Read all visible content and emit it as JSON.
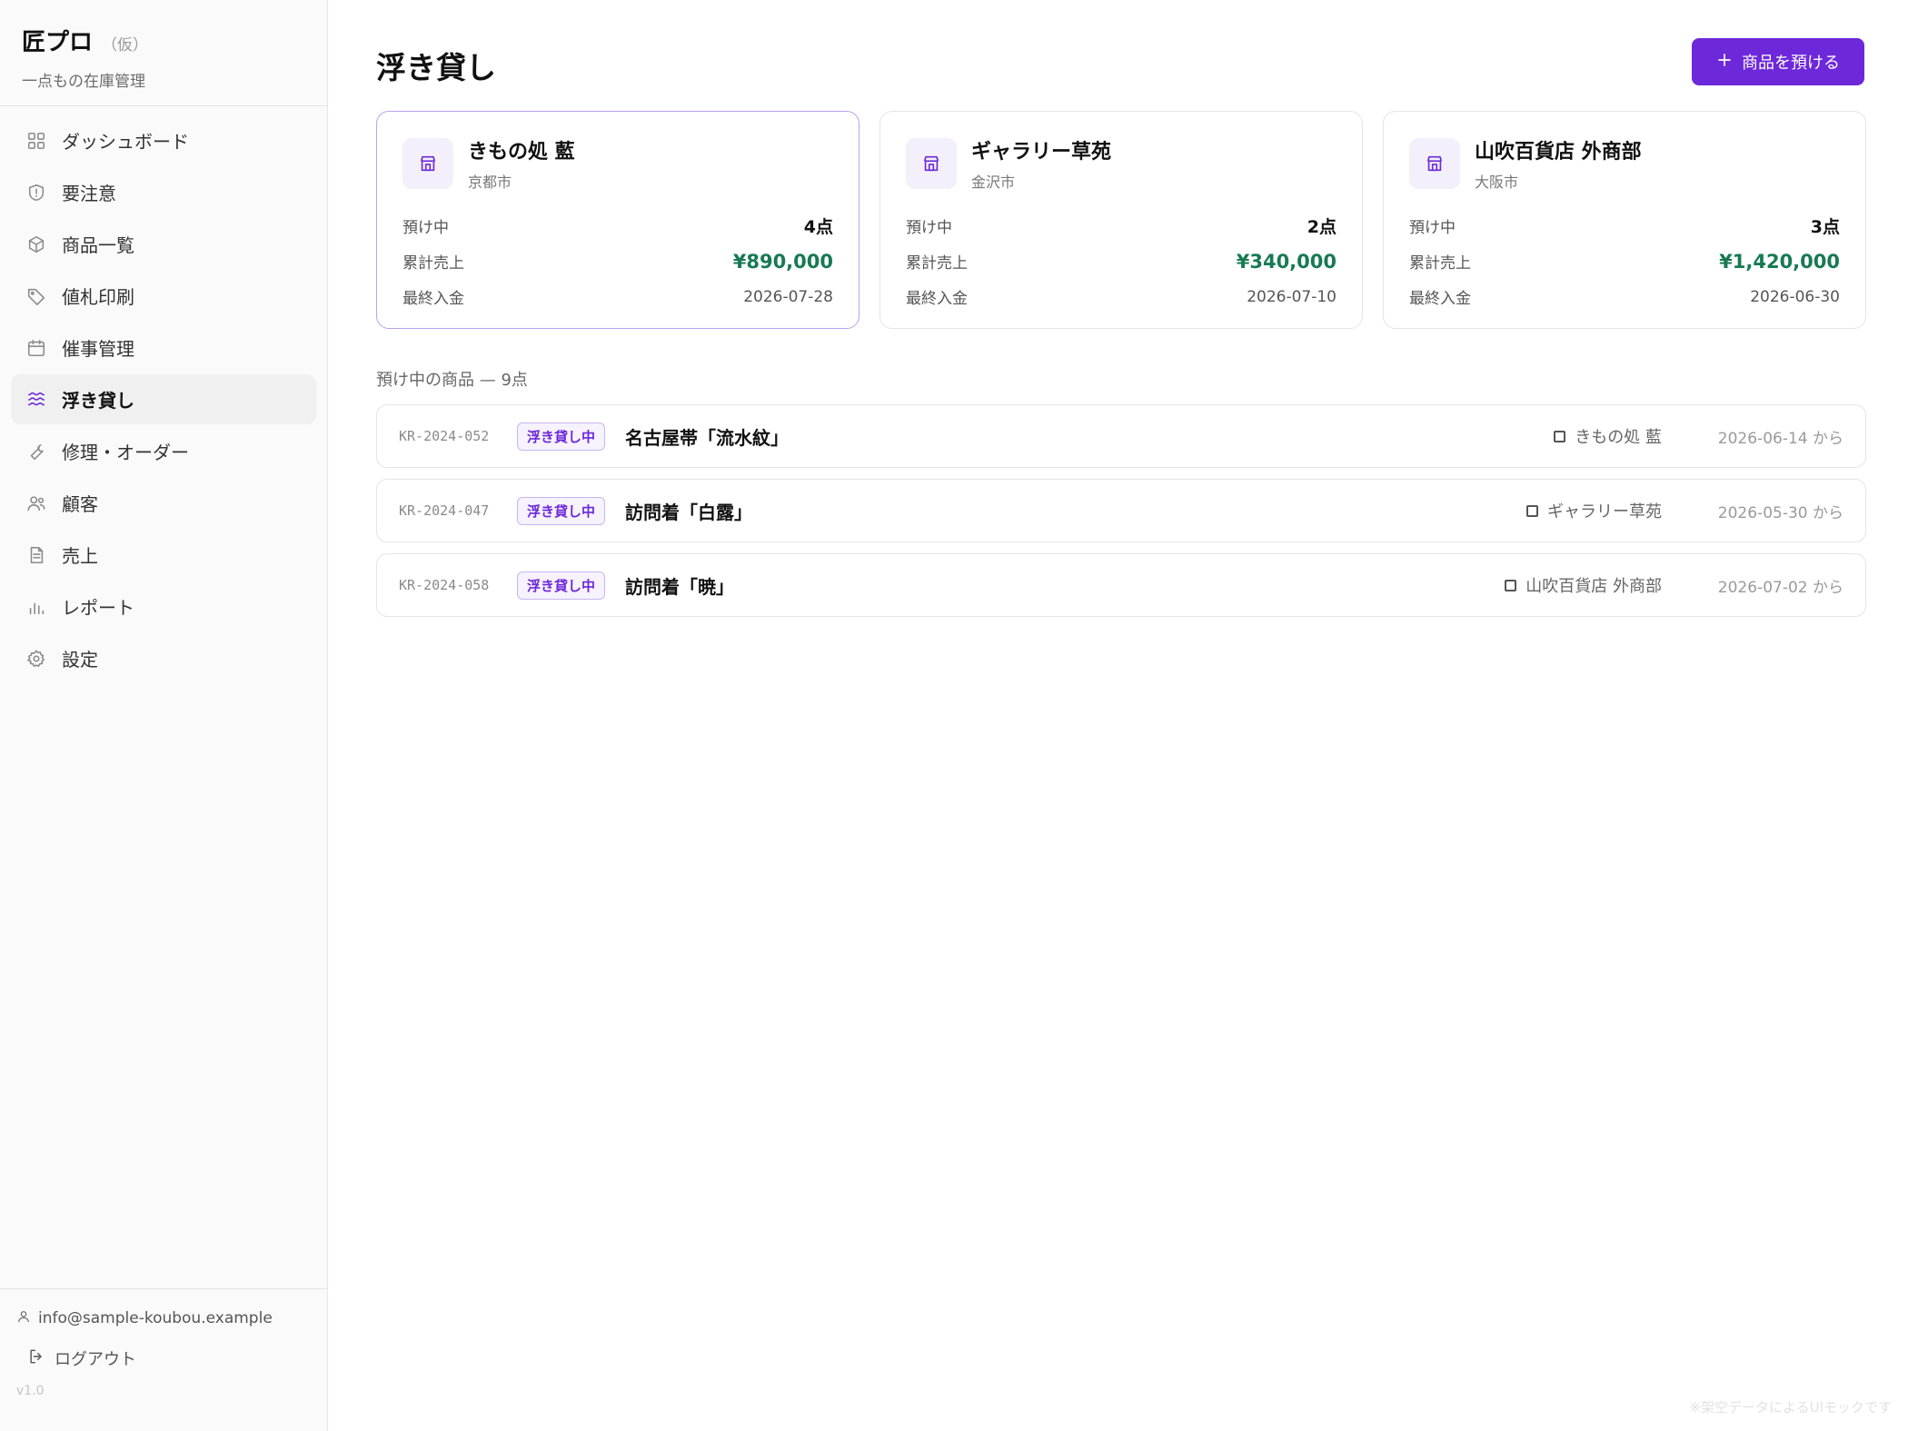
{
  "app": {
    "title": "匠プロ",
    "title_suffix": "（仮）",
    "subtitle": "一点もの在庫管理"
  },
  "nav": {
    "items": [
      {
        "label": "ダッシュボード",
        "icon": "grid-icon"
      },
      {
        "label": "要注意",
        "icon": "shield-alert-icon"
      },
      {
        "label": "商品一覧",
        "icon": "box-icon"
      },
      {
        "label": "値札印刷",
        "icon": "tag-icon"
      },
      {
        "label": "催事管理",
        "icon": "calendar-icon"
      },
      {
        "label": "浮き貸し",
        "icon": "waves-icon",
        "active": true
      },
      {
        "label": "修理・オーダー",
        "icon": "wrench-icon"
      },
      {
        "label": "顧客",
        "icon": "users-icon"
      },
      {
        "label": "売上",
        "icon": "receipt-icon"
      },
      {
        "label": "レポート",
        "icon": "bar-chart-icon"
      },
      {
        "label": "設定",
        "icon": "gear-icon"
      }
    ]
  },
  "footer": {
    "email": "info@sample-koubou.example",
    "logout": "ログアウト",
    "version": "v1.0"
  },
  "page": {
    "title": "浮き貸し",
    "primary_button": "商品を預ける",
    "section_label": "預け中の商品 — 9点"
  },
  "labels": {
    "consigned": "預け中",
    "total_sales": "累計売上",
    "last_payment": "最終入金"
  },
  "stores": [
    {
      "name": "きもの処 藍",
      "city": "京都市",
      "count": "4点",
      "sales": "¥890,000",
      "last_payment": "2026-07-28",
      "selected": true
    },
    {
      "name": "ギャラリー草苑",
      "city": "金沢市",
      "count": "2点",
      "sales": "¥340,000",
      "last_payment": "2026-07-10"
    },
    {
      "name": "山吹百貨店 外商部",
      "city": "大阪市",
      "count": "3点",
      "sales": "¥1,420,000",
      "last_payment": "2026-06-30"
    }
  ],
  "items": [
    {
      "code": "KR-2024-052",
      "badge": "浮き貸し中",
      "name": "名古屋帯「流水紋」",
      "store": "きもの処 藍",
      "since": "2026-06-14 から"
    },
    {
      "code": "KR-2024-047",
      "badge": "浮き貸し中",
      "name": "訪問着「白露」",
      "store": "ギャラリー草苑",
      "since": "2026-05-30 から"
    },
    {
      "code": "KR-2024-058",
      "badge": "浮き貸し中",
      "name": "訪問着「暁」",
      "store": "山吹百貨店 外商部",
      "since": "2026-07-02 から"
    }
  ],
  "watermark": "※架空データによるUIモックです",
  "colors": {
    "accent": "#6d28d9",
    "sales_green": "#177a52",
    "badge_bg": "#f6f2fe"
  }
}
